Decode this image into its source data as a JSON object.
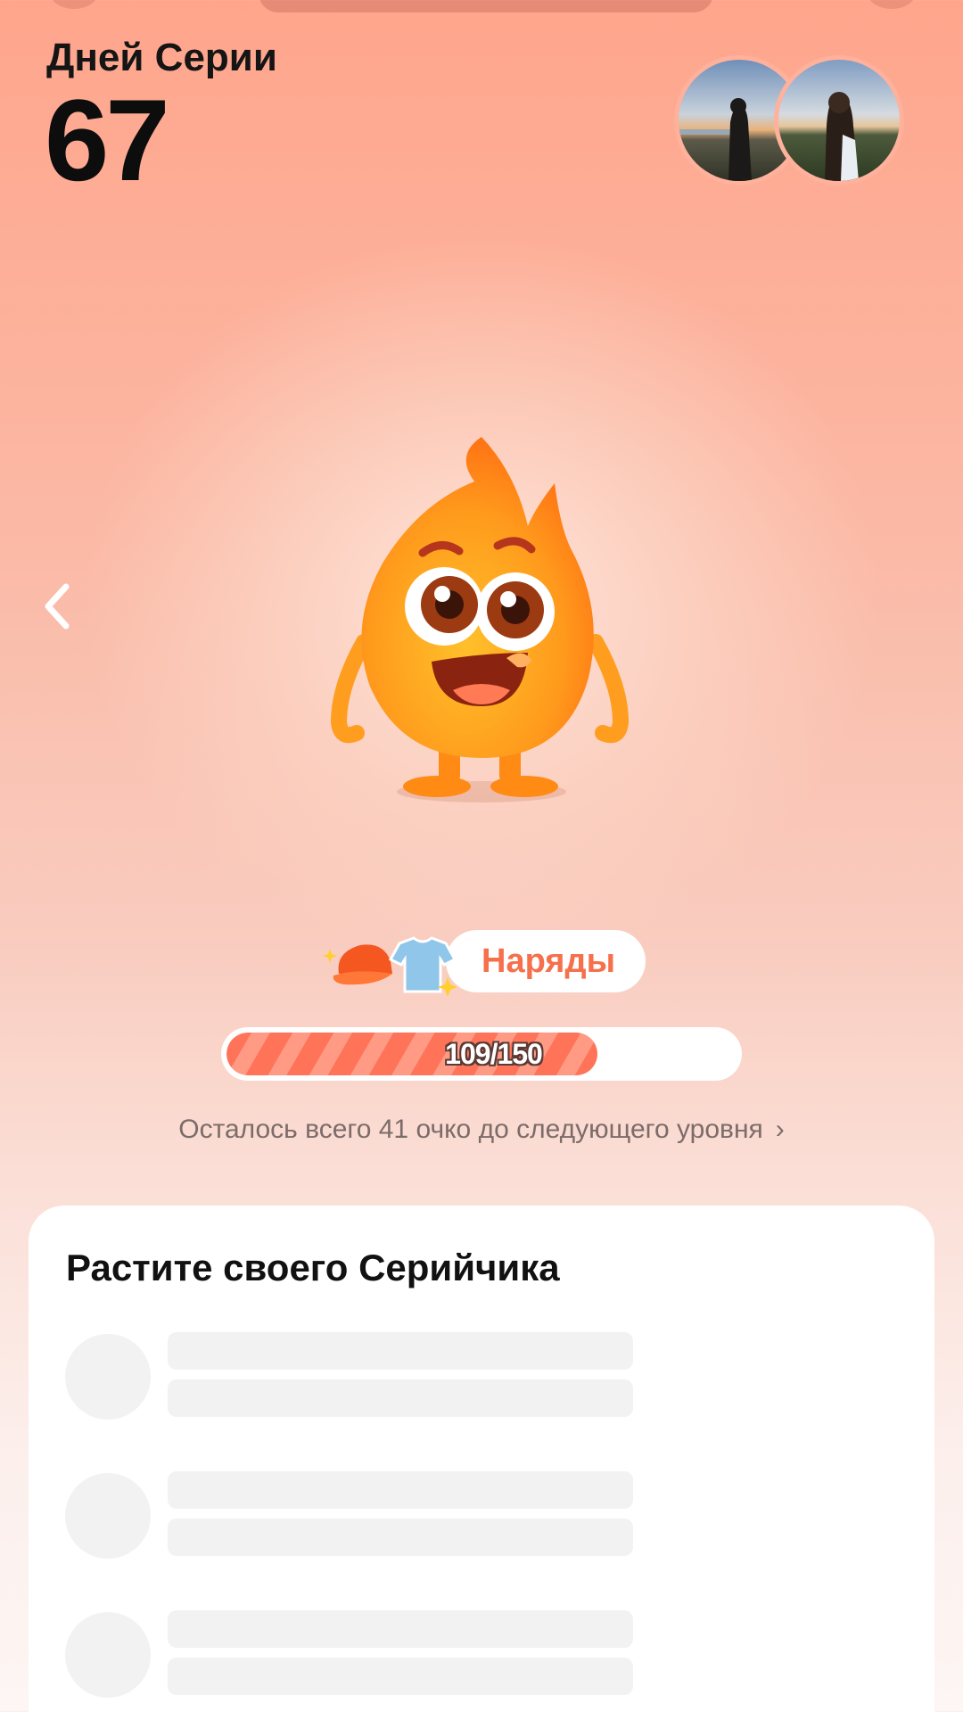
{
  "streak": {
    "label": "Дней Серии",
    "count": "67"
  },
  "avatars": [
    {
      "name": "friend-avatar-1"
    },
    {
      "name": "friend-avatar-2"
    }
  ],
  "outfits": {
    "label": "Наряды"
  },
  "progress": {
    "current": 109,
    "total": 150,
    "text": "109/150",
    "fraction": 0.727
  },
  "hint": {
    "text": "Осталось всего 41 очко до следующего уровня"
  },
  "card": {
    "title": "Растите своего Серийчика",
    "skeleton_rows": 3
  },
  "colors": {
    "accent": "#f5704b",
    "progress_fill": "#ff7458",
    "background_top": "#ffa58c",
    "background_bottom": "#fdf6f4"
  },
  "icons": {
    "back": "chevron-left-icon",
    "hint": "chevron-right-icon",
    "outfits": [
      "cap-icon",
      "tshirt-icon",
      "sparkle-icon"
    ]
  }
}
